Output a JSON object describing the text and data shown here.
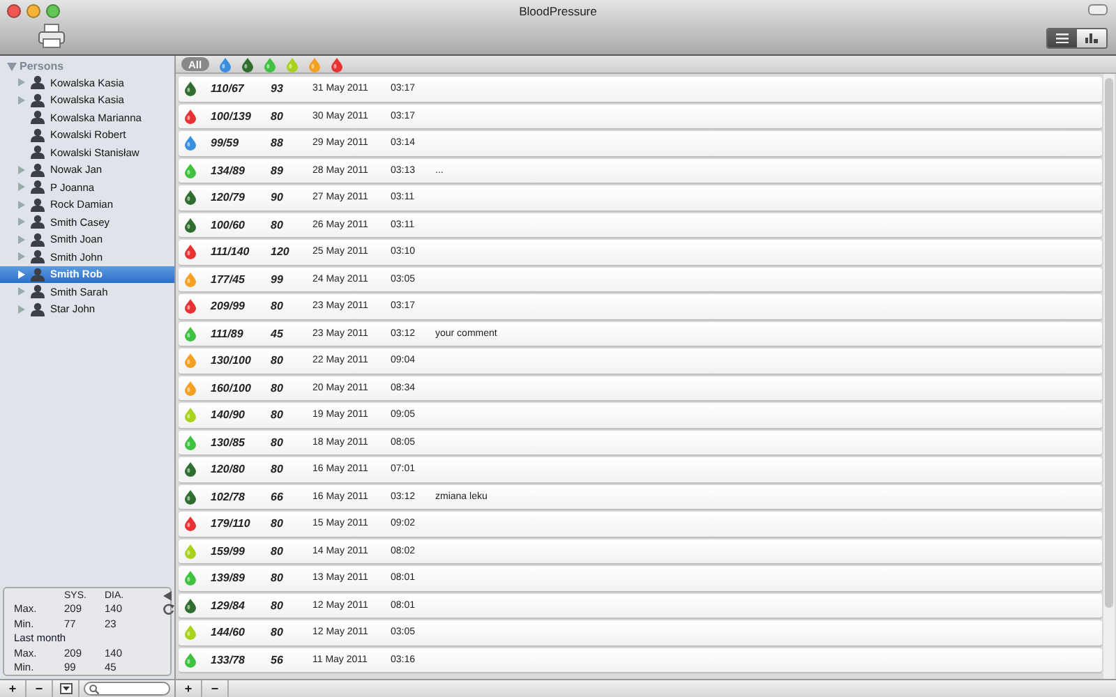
{
  "window": {
    "title": "BloodPressure"
  },
  "toolbar": {
    "view_modes": [
      {
        "kind": "list",
        "selected": true
      },
      {
        "kind": "chart",
        "selected": false
      }
    ]
  },
  "sidebar": {
    "header": "Persons",
    "expanded": true,
    "items": [
      {
        "label": "Kowalska Kasia",
        "expandable": true,
        "selected": false
      },
      {
        "label": "Kowalska Kasia",
        "expandable": true,
        "selected": false
      },
      {
        "label": "Kowalska Marianna",
        "expandable": false,
        "selected": false
      },
      {
        "label": "Kowalski Robert",
        "expandable": false,
        "selected": false
      },
      {
        "label": "Kowalski Stanisław",
        "expandable": false,
        "selected": false
      },
      {
        "label": "Nowak Jan",
        "expandable": true,
        "selected": false
      },
      {
        "label": "P Joanna",
        "expandable": true,
        "selected": false
      },
      {
        "label": "Rock Damian",
        "expandable": true,
        "selected": false
      },
      {
        "label": "Smith Casey",
        "expandable": true,
        "selected": false
      },
      {
        "label": "Smith Joan",
        "expandable": true,
        "selected": false
      },
      {
        "label": "Smith John",
        "expandable": true,
        "selected": false
      },
      {
        "label": "Smith Rob",
        "expandable": true,
        "selected": true
      },
      {
        "label": "Smith Sarah",
        "expandable": true,
        "selected": false
      },
      {
        "label": "Star John",
        "expandable": true,
        "selected": false
      }
    ]
  },
  "stats": {
    "columns": [
      "SYS.",
      "DIA."
    ],
    "rows": [
      {
        "label": "Max.",
        "sys": "209",
        "dia": "140"
      },
      {
        "label": "Min.",
        "sys": "77",
        "dia": "23"
      }
    ],
    "section": "Last month",
    "section_rows": [
      {
        "label": "Max.",
        "sys": "209",
        "dia": "140"
      },
      {
        "label": "Min.",
        "sys": "99",
        "dia": "45"
      }
    ]
  },
  "filters": {
    "all": {
      "label": "All",
      "selected": true
    },
    "colors": [
      {
        "color": "#3a8ee0"
      },
      {
        "color": "#2f6e2f"
      },
      {
        "color": "#3fc23f"
      },
      {
        "color": "#a8d21c"
      },
      {
        "color": "#f5a023"
      },
      {
        "color": "#e83232"
      }
    ]
  },
  "readings": [
    {
      "color": "#2f6e2f",
      "pressure": "110/67",
      "pulse": "93",
      "date": "31 May 2011",
      "time": "03:17"
    },
    {
      "color": "#e83232",
      "pressure": "100/139",
      "pulse": "80",
      "date": "30 May 2011",
      "time": "03:17"
    },
    {
      "color": "#3a8ee0",
      "pressure": "99/59",
      "pulse": "88",
      "date": "29 May 2011",
      "time": "03:14"
    },
    {
      "color": "#3fc23f",
      "pressure": "134/89",
      "pulse": "89",
      "date": "28 May 2011",
      "time": "03:13",
      "comment": "..."
    },
    {
      "color": "#2f6e2f",
      "pressure": "120/79",
      "pulse": "90",
      "date": "27 May 2011",
      "time": "03:11"
    },
    {
      "color": "#2f6e2f",
      "pressure": "100/60",
      "pulse": "80",
      "date": "26 May 2011",
      "time": "03:11"
    },
    {
      "color": "#e83232",
      "pressure": "111/140",
      "pulse": "120",
      "date": "25 May 2011",
      "time": "03:10"
    },
    {
      "color": "#f5a023",
      "pressure": "177/45",
      "pulse": "99",
      "date": "24 May 2011",
      "time": "03:05"
    },
    {
      "color": "#e83232",
      "pressure": "209/99",
      "pulse": "80",
      "date": "23 May 2011",
      "time": "03:17"
    },
    {
      "color": "#3fc23f",
      "pressure": "111/89",
      "pulse": "45",
      "date": "23 May 2011",
      "time": "03:12",
      "comment": "your comment"
    },
    {
      "color": "#f5a023",
      "pressure": "130/100",
      "pulse": "80",
      "date": "22 May 2011",
      "time": "09:04"
    },
    {
      "color": "#f5a023",
      "pressure": "160/100",
      "pulse": "80",
      "date": "20 May 2011",
      "time": "08:34"
    },
    {
      "color": "#a8d21c",
      "pressure": "140/90",
      "pulse": "80",
      "date": "19 May 2011",
      "time": "09:05"
    },
    {
      "color": "#3fc23f",
      "pressure": "130/85",
      "pulse": "80",
      "date": "18 May 2011",
      "time": "08:05"
    },
    {
      "color": "#2f6e2f",
      "pressure": "120/80",
      "pulse": "80",
      "date": "16 May 2011",
      "time": "07:01"
    },
    {
      "color": "#2f6e2f",
      "pressure": "102/78",
      "pulse": "66",
      "date": "16 May 2011",
      "time": "03:12",
      "comment": "zmiana leku"
    },
    {
      "color": "#e83232",
      "pressure": "179/110",
      "pulse": "80",
      "date": "15 May 2011",
      "time": "09:02"
    },
    {
      "color": "#a8d21c",
      "pressure": "159/99",
      "pulse": "80",
      "date": "14 May 2011",
      "time": "08:02"
    },
    {
      "color": "#3fc23f",
      "pressure": "139/89",
      "pulse": "80",
      "date": "13 May 2011",
      "time": "08:01"
    },
    {
      "color": "#2f6e2f",
      "pressure": "129/84",
      "pulse": "80",
      "date": "12 May 2011",
      "time": "08:01"
    },
    {
      "color": "#a8d21c",
      "pressure": "144/60",
      "pulse": "80",
      "date": "12 May 2011",
      "time": "03:05"
    },
    {
      "color": "#3fc23f",
      "pressure": "133/78",
      "pulse": "56",
      "date": "11 May 2011",
      "time": "03:16"
    }
  ],
  "bottom_bar": {
    "add": "+",
    "remove": "−"
  }
}
